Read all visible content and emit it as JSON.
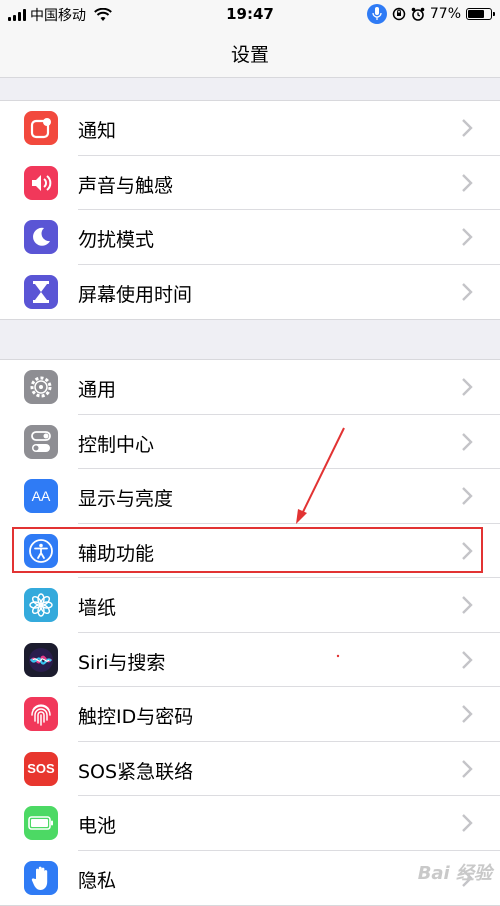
{
  "status": {
    "carrier": "中国移动",
    "time": "19:47",
    "battery": "77%",
    "battery_level": 0.77
  },
  "nav": {
    "title": "设置"
  },
  "groups": [
    {
      "items": [
        {
          "label": "通知"
        },
        {
          "label": "声音与触感"
        },
        {
          "label": "勿扰模式"
        },
        {
          "label": "屏幕使用时间"
        }
      ]
    },
    {
      "items": [
        {
          "label": "通用"
        },
        {
          "label": "控制中心"
        },
        {
          "label": "显示与亮度",
          "icon_text": "AA"
        },
        {
          "label": "辅助功能"
        },
        {
          "label": "墙纸"
        },
        {
          "label": "Siri与搜索"
        },
        {
          "label": "触控ID与密码"
        },
        {
          "label": "SOS紧急联络",
          "icon_text": "SOS"
        },
        {
          "label": "电池"
        },
        {
          "label": "隐私"
        }
      ]
    }
  ],
  "colors": {
    "notifications": "#f2493d",
    "sounds": "#f1385a",
    "dnd": "#5a55d5",
    "screentime": "#5a55d5",
    "general": "#8e8e93",
    "display": "#2f7bf5",
    "accessibility": "#2f7bf5",
    "wallpaper": "#34aadc",
    "siri": "#1c1c2e",
    "touchid": "#f1385a",
    "sos": "#e8362e",
    "battery": "#4cd964",
    "privacy": "#2f7bf5",
    "annotation": "#e23333"
  },
  "watermark": "Bai 经验"
}
